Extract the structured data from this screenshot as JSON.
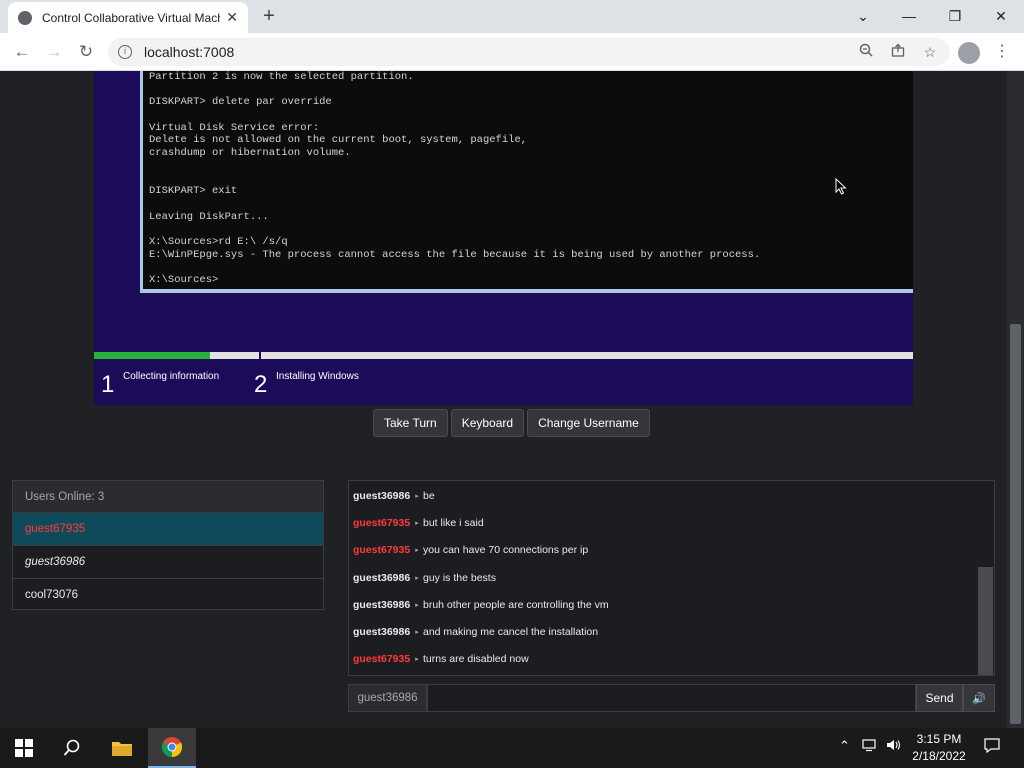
{
  "browser": {
    "tab_title": "Control Collaborative Virtual Machine",
    "tab_close": "✕",
    "new_tab": "+",
    "url": "localhost:7008",
    "window_controls": {
      "minimize": "—",
      "maximize": "❐",
      "close": "✕",
      "tab_search": "⌄"
    },
    "nav": {
      "back": "←",
      "forward": "→",
      "reload": "↻"
    }
  },
  "vm_screen": {
    "console_lines": [
      "Partition 2 is now the selected partition.",
      "",
      "DISKPART> delete par override",
      "",
      "Virtual Disk Service error:",
      "Delete is not allowed on the current boot, system, pagefile,",
      "crashdump or hibernation volume.",
      "",
      "",
      "DISKPART> exit",
      "",
      "Leaving DiskPart...",
      "",
      "X:\\Sources>rd E:\\ /s/q",
      "E:\\WinPEpge.sys - The process cannot access the file because it is being used by another process.",
      "",
      "X:\\Sources>"
    ],
    "setup_steps": [
      {
        "number": "1",
        "label": "Collecting information",
        "progress": 0.7
      },
      {
        "number": "2",
        "label": "Installing Windows",
        "progress": 0.0
      }
    ],
    "colors": {
      "background": "#1c0b59",
      "progress_fill": "#28b43c"
    }
  },
  "controls": {
    "take_turn": "Take Turn",
    "keyboard": "Keyboard",
    "change_username": "Change Username"
  },
  "users": {
    "header": "Users Online: 3",
    "list": [
      {
        "name": "guest67935",
        "state": "active"
      },
      {
        "name": "guest36986",
        "state": "self"
      },
      {
        "name": "cool73076",
        "state": "normal"
      }
    ]
  },
  "chat": {
    "messages": [
      {
        "user": "guest36986",
        "text": "be",
        "color": "#e8eaed"
      },
      {
        "user": "guest67935",
        "text": "but like i said",
        "color": "#ff3a3a"
      },
      {
        "user": "guest67935",
        "text": "you can have 70 connections per ip",
        "color": "#ff3a3a"
      },
      {
        "user": "guest36986",
        "text": "guy is the bests",
        "color": "#e8eaed"
      },
      {
        "user": "guest36986",
        "text": "bruh other people are controlling the vm",
        "color": "#e8eaed"
      },
      {
        "user": "guest36986",
        "text": "and making me cancel the installation",
        "color": "#e8eaed"
      },
      {
        "user": "guest67935",
        "text": "turns are disabled now",
        "color": "#ff3a3a"
      }
    ],
    "username": "guest36986",
    "input_value": "",
    "send": "Send",
    "volume_icon": "🔊"
  },
  "taskbar": {
    "time": "3:15 PM",
    "date": "2/18/2022"
  }
}
